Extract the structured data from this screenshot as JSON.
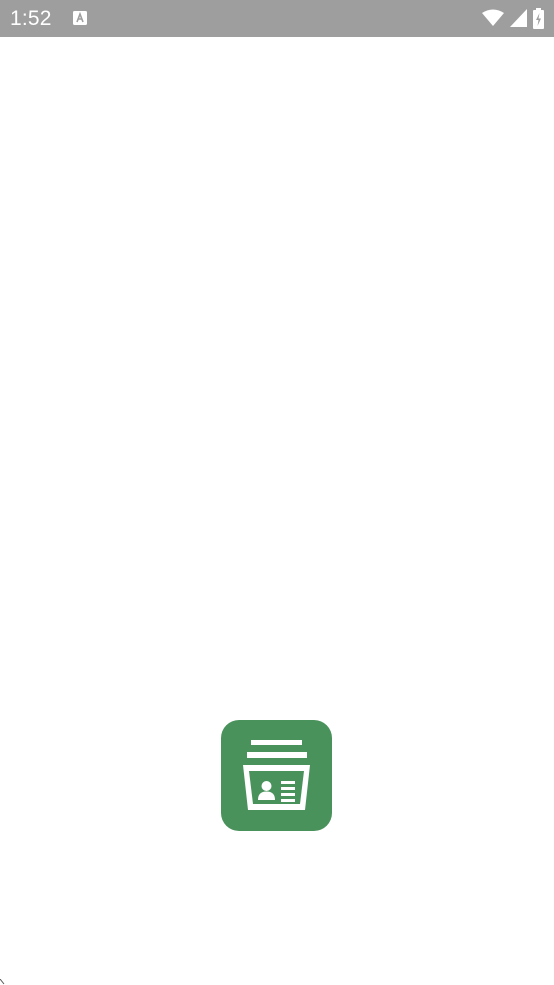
{
  "status_bar": {
    "time": "1:52",
    "icons": [
      "notification-a-icon",
      "wifi-icon",
      "signal-icon",
      "battery-charging-icon"
    ],
    "background": "#9e9e9e"
  },
  "splash": {
    "logo_icon": "id-card-stack-icon",
    "logo_color": "#4a925c"
  }
}
